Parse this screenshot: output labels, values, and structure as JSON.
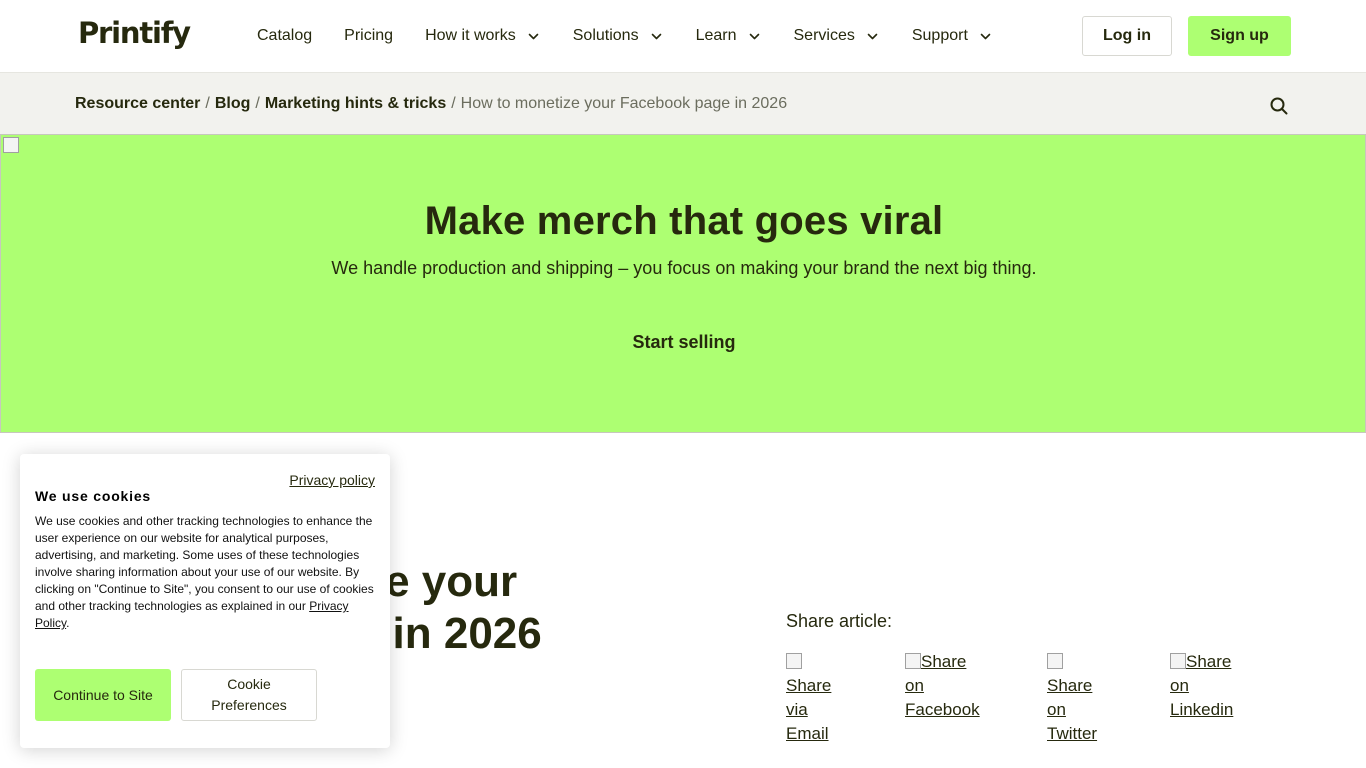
{
  "header": {
    "logo": "Printify",
    "nav": [
      {
        "label": "Catalog",
        "has_dropdown": false
      },
      {
        "label": "Pricing",
        "has_dropdown": false
      },
      {
        "label": "How it works",
        "has_dropdown": true
      },
      {
        "label": "Solutions",
        "has_dropdown": true
      },
      {
        "label": "Learn",
        "has_dropdown": true
      },
      {
        "label": "Services",
        "has_dropdown": true
      },
      {
        "label": "Support",
        "has_dropdown": true
      }
    ],
    "login_label": "Log in",
    "signup_label": "Sign up"
  },
  "breadcrumb": {
    "items": [
      "Resource center",
      "Blog",
      "Marketing hints & tricks"
    ],
    "separator": "/",
    "current": "How to monetize your Facebook page in 2026",
    "search_icon": "search-icon"
  },
  "hero": {
    "title": "Make merch that goes viral",
    "subtitle": "We handle production and shipping – you focus on making your brand the next big thing.",
    "cta": "Start selling",
    "background": "#adff72"
  },
  "article": {
    "title_line1": "How to monetize your",
    "title_line2": "Facebook page in 2026"
  },
  "share": {
    "label": "Share article:",
    "links": [
      {
        "line1": "Share via",
        "line2": "Email"
      },
      {
        "line1": "Share on",
        "line2": "Facebook"
      },
      {
        "line1": "Share on",
        "line2": "Twitter"
      },
      {
        "line1": "Share on",
        "line2": "Linkedin"
      }
    ]
  },
  "cookie": {
    "privacy_link": "Privacy policy",
    "title": "We use cookies",
    "body": "We use cookies and other tracking technologies to enhance the user experience on our website for analytical purposes, advertising, and marketing. Some uses of these technologies involve sharing information about your use of our website. By clicking on \"Continue to Site\", you consent to our use of cookies and other tracking technologies as explained in our ",
    "body_link": "Privacy Policy",
    "body_end": ".",
    "continue_label": "Continue to Site",
    "prefs_label": "Cookie Preferences"
  },
  "colors": {
    "brand_green": "#adff72",
    "text_dark": "#26290e",
    "crumb_bg": "#f2f2ee"
  }
}
